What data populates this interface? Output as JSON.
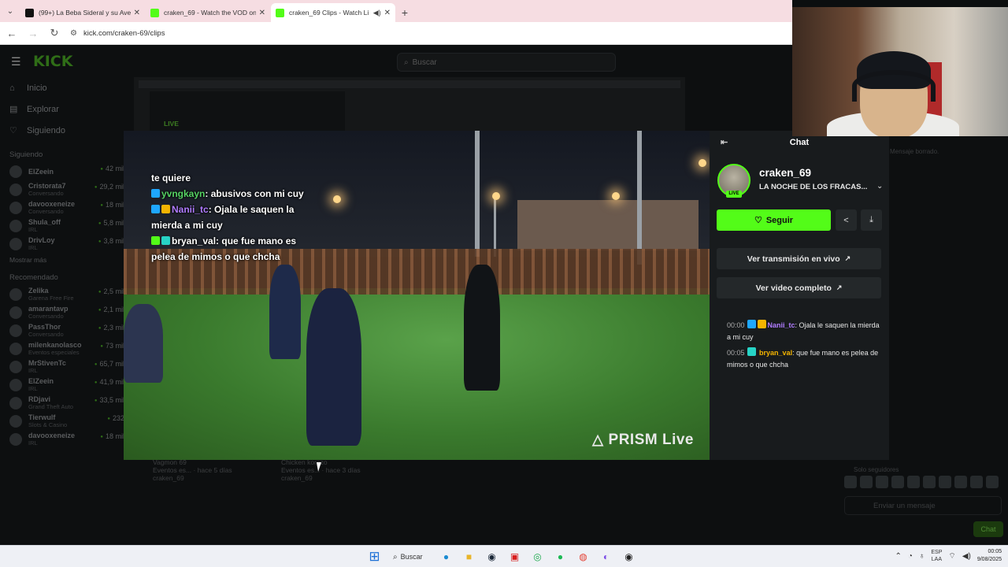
{
  "browser": {
    "tabs": [
      {
        "title": "(99+) La Beba Sideral y su Aven",
        "favicon": "tiktok-icon",
        "active": false
      },
      {
        "title": "craken_69 - Watch the VOD on",
        "favicon": "kick-icon",
        "active": false
      },
      {
        "title": "craken_69 Clips - Watch Li",
        "favicon": "kick-icon",
        "active": true
      }
    ],
    "url": "kick.com/craken-69/clips"
  },
  "kick": {
    "logo": "KICK",
    "search_placeholder": "Buscar",
    "nav": [
      {
        "label": "Inicio",
        "icon": "home-icon"
      },
      {
        "label": "Explorar",
        "icon": "compass-icon"
      },
      {
        "label": "Siguiendo",
        "icon": "heart-icon"
      }
    ],
    "following_heading": "Siguiendo",
    "following": [
      {
        "name": "ElZeein",
        "sub": "",
        "viewers": "42 mil"
      },
      {
        "name": "Cristorata7",
        "sub": "Conversando",
        "viewers": "29,2 mil"
      },
      {
        "name": "davooxeneize",
        "sub": "Conversando",
        "viewers": "18 mil"
      },
      {
        "name": "Shula_off",
        "sub": "IRL",
        "viewers": "5,8 mil"
      },
      {
        "name": "DrivLoy",
        "sub": "IRL",
        "viewers": "3,8 mil"
      }
    ],
    "show_more": "Mostrar más",
    "recommended_heading": "Recomendado",
    "recommended": [
      {
        "name": "Zelika",
        "sub": "Garena Free Fire",
        "viewers": "2,5 mil"
      },
      {
        "name": "amarantavp",
        "sub": "Conversando",
        "viewers": "2,1 mil"
      },
      {
        "name": "PassThor",
        "sub": "Conversando",
        "viewers": "2,3 mil"
      },
      {
        "name": "milenkanolasco",
        "sub": "Eventos especiales",
        "viewers": "73 mil"
      },
      {
        "name": "MrStivenTc",
        "sub": "IRL",
        "viewers": "65,7 mil"
      },
      {
        "name": "ElZeein",
        "sub": "IRL",
        "viewers": "41,9 mil"
      },
      {
        "name": "RDjavi",
        "sub": "Grand Theft Auto",
        "viewers": "33,5 mil"
      },
      {
        "name": "Tierwulf",
        "sub": "Slots & Casino",
        "viewers": "232"
      },
      {
        "name": "davooxeneize",
        "sub": "IRL",
        "viewers": "18 mil"
      }
    ],
    "live_tag": "LIVE",
    "below_video": [
      {
        "title": "Vagmon 69",
        "meta": "Eventos es... · hace 5 días",
        "channel": "craken_69"
      },
      {
        "title": "Chicken korazo",
        "meta": "Eventos es... · hace 3 días",
        "channel": "craken_69"
      }
    ],
    "ghost_deleted": "Mensaje borrado.",
    "ghost_subs": "Solo seguidores",
    "ghost_message_placeholder": "Enviar un mensaje",
    "ghost_chat_btn": "Chat"
  },
  "video": {
    "overlay_lines": {
      "line0": "te quiere",
      "u1": "yvngkayn",
      "m1": ": abusivos con mi cuy",
      "u2": "Nanii_tc",
      "m2": ": Ojala le saquen la mierda a mi cuy",
      "u3": "bryan_val",
      "m3": ": que fue mano es pelea de mimos o que chcha"
    },
    "watermark": "PRISM Live"
  },
  "panel": {
    "header": "Chat",
    "streamer_name": "craken_69",
    "stream_title": "LA NOCHE DE LOS FRACAS...",
    "live_badge": "LIVE",
    "follow_label": "Seguir",
    "watch_live_label": "Ver transmisión en vivo",
    "full_video_label": "Ver video completo",
    "messages": [
      {
        "time": "00:00",
        "user": "Nanii_tc",
        "text": ": Ojala le saquen la mierda a mi cuy"
      },
      {
        "time": "00:05",
        "user": "bryan_val",
        "text": ": que fue mano es pelea de mimos o que chcha"
      }
    ]
  },
  "taskbar": {
    "search_label": "Buscar",
    "lang_top": "ESP",
    "lang_bottom": "LAA",
    "time": "00:05",
    "date": "9/08/2025"
  }
}
